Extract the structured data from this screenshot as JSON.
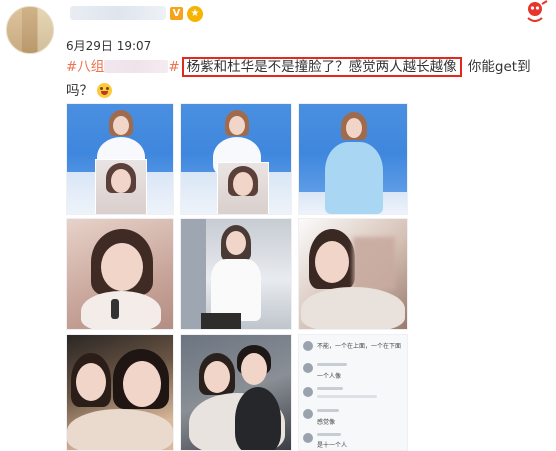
{
  "post": {
    "time": "6月29日 19:07",
    "tag_prefix": "#八组",
    "tag_suffix": "#",
    "highlight_text": "杨紫和杜华是不是撞脸了？感觉两人越长越像",
    "rest_text": " 你能get到吗？",
    "verified_badge": "V"
  },
  "images": [
    {
      "name": "photo-1"
    },
    {
      "name": "photo-2"
    },
    {
      "name": "photo-3"
    },
    {
      "name": "photo-4"
    },
    {
      "name": "photo-5"
    },
    {
      "name": "photo-6"
    },
    {
      "name": "photo-7"
    },
    {
      "name": "photo-8"
    },
    {
      "name": "photo-9"
    }
  ],
  "chat": {
    "lines": [
      "不能，一个在上面，一个在下面",
      "一个人像",
      "...",
      "感觉像",
      "是十一个人"
    ]
  },
  "colors": {
    "tag": "#eb7350",
    "highlight_border": "#e4281e",
    "verified": "#f7a21b"
  }
}
